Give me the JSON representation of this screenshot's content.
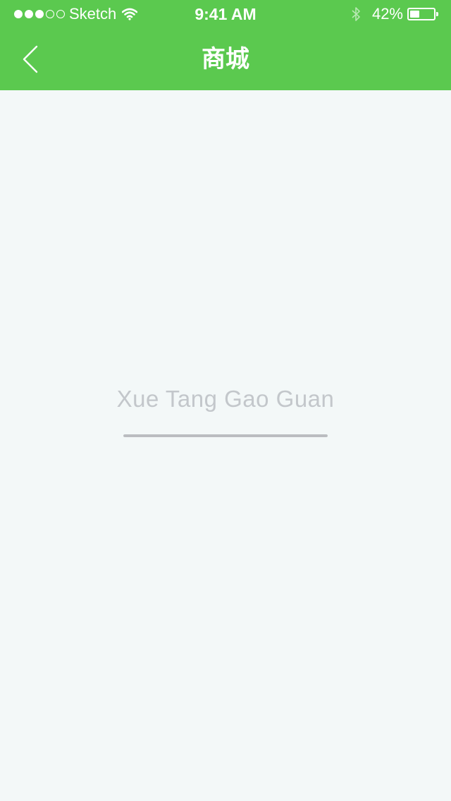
{
  "status_bar": {
    "carrier": "Sketch",
    "time": "9:41 AM",
    "battery_text": "42%",
    "battery_level": 0.42,
    "signal_bars_filled": 3,
    "signal_bars_total": 5,
    "icons": [
      "wifi-icon",
      "bluetooth-icon",
      "battery-icon"
    ]
  },
  "nav": {
    "title": "商城",
    "back_icon": "chevron-left-icon"
  },
  "loading": {
    "brand_text": "Xue Tang Gao Guan",
    "progress": 1.0
  },
  "colors": {
    "header_green": "#5bc94f",
    "background": "#f3f8f8",
    "brand_text": "#c3c7cb",
    "progress_bar": "#babdc0"
  }
}
